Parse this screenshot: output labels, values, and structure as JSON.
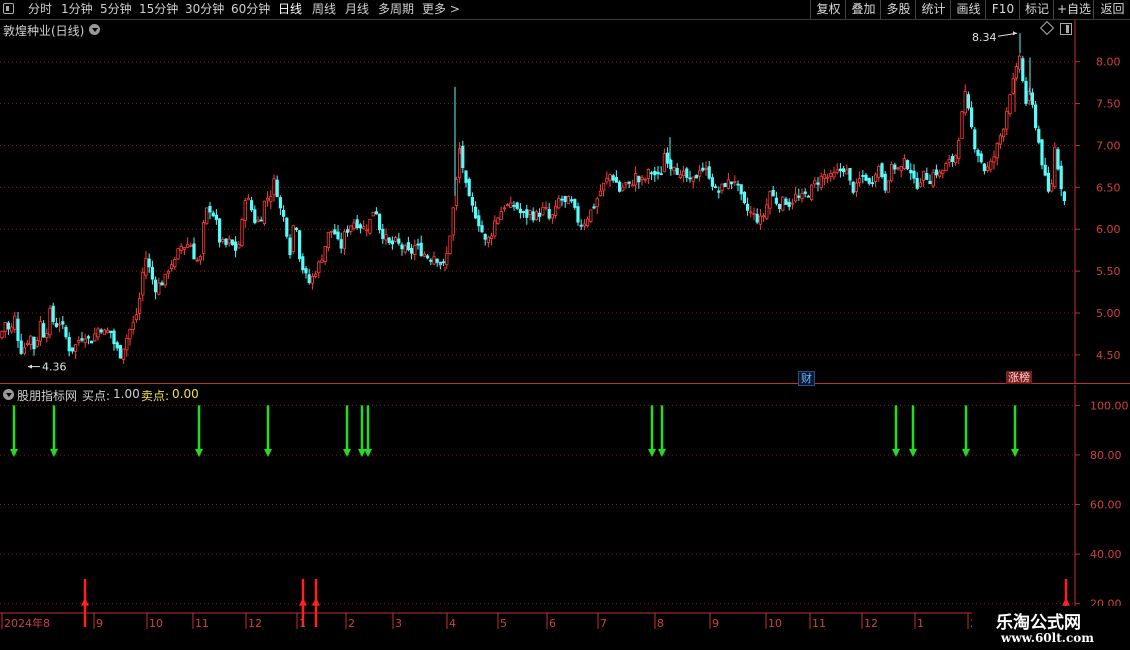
{
  "toolbar": {
    "periods": [
      "分时",
      "1分钟",
      "5分钟",
      "15分钟",
      "30分钟",
      "60分钟",
      "日线",
      "周线",
      "月线",
      "多周期",
      "更多 >"
    ],
    "active_period": "日线",
    "right_buttons": [
      "复权",
      "叠加",
      "多股",
      "统计",
      "画线",
      "F10",
      "标记",
      "+自选",
      "返回"
    ]
  },
  "main_pane": {
    "title": "敦煌种业(日线)",
    "high_label": "8.34",
    "low_label": "4.36",
    "badges": {
      "finance": "财",
      "limit_up": "涨榜"
    }
  },
  "indicator_pane": {
    "name": "股朋指标网",
    "buy_label": "买点:",
    "buy_value": "1.00",
    "sell_label": "卖点:",
    "sell_value": "0.00"
  },
  "watermark": {
    "title": "乐淘公式网",
    "url": "www.60lt.com"
  },
  "colors": {
    "up": "#ff3c3c",
    "down": "#54fcfc",
    "sell_arrow": "#22dd22",
    "buy_arrow": "#ff2020",
    "grid": "#8b1a1a",
    "axis": "#c03030"
  },
  "chart_data": [
    {
      "type": "candlestick",
      "title": "敦煌种业(日线)",
      "y_ticks": [
        4.5,
        5.0,
        5.5,
        6.0,
        6.5,
        7.0,
        7.5,
        8.0
      ],
      "ylim": [
        4.2,
        8.45
      ],
      "x_ticks": [
        "2024年8",
        "9",
        "10",
        "11",
        "12",
        "1",
        "2",
        "3",
        "4",
        "5",
        "6",
        "7",
        "8",
        "9",
        "10",
        "11",
        "12",
        "1",
        "2"
      ],
      "annotations": [
        {
          "text": "8.34",
          "value": 8.34
        },
        {
          "text": "4.36",
          "value": 4.36
        }
      ],
      "close_path": [
        [
          0,
          4.7
        ],
        [
          5,
          4.9
        ],
        [
          10,
          4.75
        ],
        [
          15,
          4.95
        ],
        [
          20,
          4.55
        ],
        [
          25,
          4.6
        ],
        [
          30,
          4.75
        ],
        [
          35,
          4.55
        ],
        [
          40,
          4.9
        ],
        [
          45,
          4.7
        ],
        [
          50,
          5.0
        ],
        [
          55,
          4.85
        ],
        [
          60,
          4.9
        ],
        [
          65,
          4.75
        ],
        [
          70,
          4.55
        ],
        [
          75,
          4.6
        ],
        [
          80,
          4.7
        ],
        [
          85,
          4.75
        ],
        [
          90,
          4.65
        ],
        [
          95,
          4.75
        ],
        [
          100,
          4.85
        ],
        [
          105,
          4.75
        ],
        [
          110,
          4.8
        ],
        [
          115,
          4.6
        ],
        [
          120,
          4.5
        ],
        [
          125,
          4.65
        ],
        [
          130,
          4.8
        ],
        [
          135,
          4.9
        ],
        [
          140,
          5.2
        ],
        [
          145,
          5.7
        ],
        [
          150,
          5.5
        ],
        [
          155,
          5.3
        ],
        [
          160,
          5.35
        ],
        [
          165,
          5.4
        ],
        [
          170,
          5.6
        ],
        [
          175,
          5.6
        ],
        [
          180,
          5.8
        ],
        [
          185,
          5.8
        ],
        [
          190,
          5.85
        ],
        [
          195,
          5.65
        ],
        [
          200,
          5.6
        ],
        [
          205,
          6.2
        ],
        [
          210,
          6.25
        ],
        [
          215,
          6.15
        ],
        [
          220,
          5.85
        ],
        [
          225,
          5.8
        ],
        [
          230,
          5.85
        ],
        [
          235,
          5.75
        ],
        [
          240,
          5.85
        ],
        [
          245,
          6.4
        ],
        [
          250,
          6.3
        ],
        [
          255,
          6.1
        ],
        [
          260,
          6.1
        ],
        [
          265,
          6.35
        ],
        [
          270,
          6.4
        ],
        [
          275,
          6.6
        ],
        [
          280,
          6.25
        ],
        [
          285,
          6.1
        ],
        [
          290,
          5.75
        ],
        [
          295,
          6.2
        ],
        [
          300,
          5.65
        ],
        [
          305,
          5.45
        ],
        [
          310,
          5.35
        ],
        [
          315,
          5.5
        ],
        [
          320,
          5.6
        ],
        [
          325,
          5.8
        ],
        [
          330,
          6.0
        ],
        [
          335,
          5.95
        ],
        [
          340,
          5.75
        ],
        [
          345,
          5.95
        ],
        [
          350,
          6.05
        ],
        [
          355,
          6.1
        ],
        [
          360,
          6.05
        ],
        [
          365,
          6.0
        ],
        [
          370,
          6.1
        ],
        [
          375,
          6.3
        ],
        [
          380,
          6.0
        ],
        [
          385,
          5.9
        ],
        [
          390,
          5.8
        ],
        [
          395,
          5.85
        ],
        [
          400,
          5.8
        ],
        [
          405,
          5.75
        ],
        [
          410,
          5.7
        ],
        [
          415,
          5.8
        ],
        [
          420,
          5.75
        ],
        [
          425,
          5.7
        ],
        [
          430,
          5.65
        ],
        [
          435,
          5.7
        ],
        [
          440,
          5.6
        ],
        [
          445,
          5.55
        ],
        [
          450,
          5.95
        ],
        [
          455,
          6.4
        ],
        [
          460,
          7.0
        ],
        [
          465,
          6.55
        ],
        [
          470,
          6.3
        ],
        [
          475,
          6.2
        ],
        [
          480,
          6.05
        ],
        [
          485,
          5.85
        ],
        [
          490,
          5.9
        ],
        [
          495,
          6.1
        ],
        [
          500,
          6.2
        ],
        [
          505,
          6.3
        ],
        [
          510,
          6.25
        ],
        [
          515,
          6.3
        ],
        [
          520,
          6.2
        ],
        [
          525,
          6.15
        ],
        [
          530,
          6.2
        ],
        [
          535,
          6.15
        ],
        [
          540,
          6.2
        ],
        [
          545,
          6.25
        ],
        [
          550,
          6.1
        ],
        [
          555,
          6.2
        ],
        [
          560,
          6.4
        ],
        [
          565,
          6.3
        ],
        [
          570,
          6.35
        ],
        [
          575,
          6.2
        ],
        [
          580,
          6.05
        ],
        [
          585,
          6.1
        ],
        [
          590,
          6.2
        ],
        [
          595,
          6.3
        ],
        [
          600,
          6.45
        ],
        [
          605,
          6.55
        ],
        [
          610,
          6.65
        ],
        [
          615,
          6.6
        ],
        [
          620,
          6.45
        ],
        [
          625,
          6.55
        ],
        [
          630,
          6.5
        ],
        [
          635,
          6.65
        ],
        [
          640,
          6.55
        ],
        [
          645,
          6.6
        ],
        [
          650,
          6.7
        ],
        [
          655,
          6.65
        ],
        [
          660,
          6.6
        ],
        [
          665,
          6.95
        ],
        [
          670,
          6.75
        ],
        [
          675,
          6.8
        ],
        [
          680,
          6.6
        ],
        [
          685,
          6.65
        ],
        [
          690,
          6.55
        ],
        [
          695,
          6.6
        ],
        [
          700,
          6.75
        ],
        [
          705,
          6.7
        ],
        [
          710,
          6.65
        ],
        [
          715,
          6.45
        ],
        [
          720,
          6.45
        ],
        [
          725,
          6.55
        ],
        [
          730,
          6.55
        ],
        [
          735,
          6.6
        ],
        [
          740,
          6.4
        ],
        [
          745,
          6.25
        ],
        [
          750,
          6.2
        ],
        [
          755,
          6.15
        ],
        [
          760,
          6.1
        ],
        [
          765,
          6.2
        ],
        [
          770,
          6.45
        ],
        [
          775,
          6.35
        ],
        [
          780,
          6.3
        ],
        [
          785,
          6.35
        ],
        [
          790,
          6.3
        ],
        [
          795,
          6.4
        ],
        [
          800,
          6.35
        ],
        [
          805,
          6.4
        ],
        [
          810,
          6.45
        ],
        [
          815,
          6.55
        ],
        [
          820,
          6.6
        ],
        [
          825,
          6.65
        ],
        [
          830,
          6.6
        ],
        [
          835,
          6.65
        ],
        [
          840,
          6.7
        ],
        [
          845,
          6.75
        ],
        [
          850,
          6.55
        ],
        [
          855,
          6.45
        ],
        [
          860,
          6.6
        ],
        [
          865,
          6.65
        ],
        [
          870,
          6.5
        ],
        [
          875,
          6.7
        ],
        [
          880,
          6.75
        ],
        [
          885,
          6.5
        ],
        [
          890,
          6.7
        ],
        [
          895,
          6.75
        ],
        [
          900,
          6.7
        ],
        [
          905,
          6.8
        ],
        [
          910,
          6.75
        ],
        [
          915,
          6.5
        ],
        [
          920,
          6.6
        ],
        [
          925,
          6.65
        ],
        [
          930,
          6.6
        ],
        [
          935,
          6.7
        ],
        [
          940,
          6.65
        ],
        [
          945,
          6.75
        ],
        [
          950,
          6.8
        ],
        [
          955,
          6.85
        ],
        [
          960,
          7.2
        ],
        [
          965,
          7.6
        ],
        [
          970,
          7.3
        ],
        [
          975,
          7.0
        ],
        [
          980,
          6.85
        ],
        [
          985,
          6.7
        ],
        [
          990,
          6.75
        ],
        [
          995,
          6.9
        ],
        [
          1000,
          7.1
        ],
        [
          1005,
          7.3
        ],
        [
          1010,
          7.65
        ],
        [
          1015,
          7.8
        ],
        [
          1020,
          8.1
        ],
        [
          1025,
          7.5
        ],
        [
          1030,
          7.6
        ],
        [
          1035,
          7.3
        ],
        [
          1040,
          6.95
        ],
        [
          1045,
          6.6
        ],
        [
          1050,
          6.35
        ],
        [
          1055,
          7.0
        ],
        [
          1060,
          6.6
        ],
        [
          1065,
          6.3
        ]
      ],
      "highlight_points": [
        [
          440,
          5.55
        ],
        [
          445,
          5.5
        ],
        [
          455,
          7.7
        ],
        [
          460,
          6.9
        ],
        [
          670,
          7.1
        ],
        [
          1015,
          7.4
        ],
        [
          1020,
          8.34
        ],
        [
          1030,
          8.05
        ]
      ]
    },
    {
      "type": "signal-bars",
      "title": "股朋指标网",
      "y_ticks": [
        20.0,
        40.0,
        60.0,
        80.0,
        100.0
      ],
      "ylim": [
        13,
        105
      ],
      "sell_signals_x": [
        14,
        54,
        199,
        268,
        347,
        362,
        368,
        652,
        662,
        896,
        913,
        966,
        1015
      ],
      "buy_signals_x": [
        85,
        303,
        316,
        1066
      ],
      "sell_signal_level": 80,
      "sell_signal_top": 100,
      "buy_signal_level": 13,
      "buy_signal_top": 30
    }
  ]
}
